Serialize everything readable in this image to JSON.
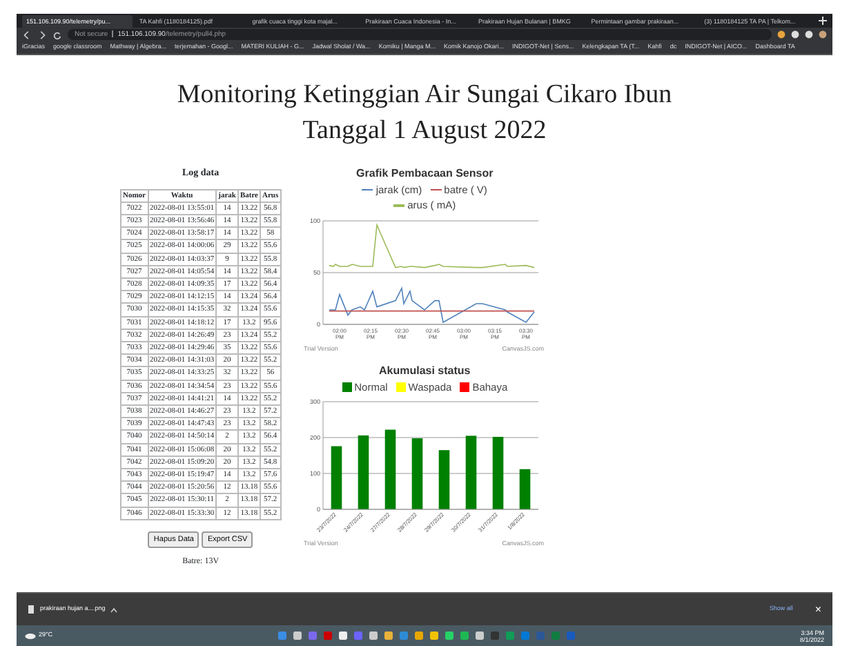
{
  "browser": {
    "tabs": [
      {
        "title": "151.106.109.90/telemetry/pu...",
        "selected": true
      },
      {
        "title": "TA Kahfi (1180184125).pdf",
        "selected": false
      },
      {
        "title": "grafik cuaca tinggi kota majal...",
        "selected": false
      },
      {
        "title": "Prakiraan Cuaca Indonesia - In...",
        "selected": false
      },
      {
        "title": "Prakiraan Hujan Bulanan | BMKG",
        "selected": false
      },
      {
        "title": "Permintaan gambar prakiraan...",
        "selected": false
      },
      {
        "title": "(3) 1180184125 TA PA | Telkom...",
        "selected": false
      }
    ],
    "address": {
      "security": "Not secure",
      "host": "151.106.109.90",
      "path": "/telemetry/pull4.php"
    },
    "bookmarks": [
      "iGracias",
      "google classroom",
      "Mathway | Algebra...",
      "terjemahan - Googl...",
      "MATERI KULIAH - G...",
      "Jadwal Sholat / Wa...",
      "Komiku | Manga M...",
      "Komik Kanojo Okari...",
      "INDIGOT-Net | Sens...",
      "Kelengkapan TA (T...",
      "Kahfi",
      "dc",
      "INDIGOT-Net | AICO...",
      "Dashboard TA"
    ]
  },
  "page": {
    "title_lines": [
      "Monitoring Ketinggian Air Sungai Cikaro Ibun",
      "Tanggal 1 August 2022"
    ],
    "log": {
      "heading": "Log data",
      "columns": [
        "Nomor",
        "Waktu",
        "jarak",
        "Batre",
        "Arus"
      ],
      "rows": [
        [
          "7022",
          "2022-08-01 13:55:01",
          "14",
          "13.22",
          "56.8"
        ],
        [
          "7023",
          "2022-08-01 13:56:46",
          "14",
          "13.22",
          "55.8"
        ],
        [
          "7024",
          "2022-08-01 13:58:17",
          "14",
          "13.22",
          "58"
        ],
        [
          "7025",
          "2022-08-01 14:00:06",
          "29",
          "13.22",
          "55.6"
        ],
        [
          "7026",
          "2022-08-01 14:03:37",
          "9",
          "13.22",
          "55.8"
        ],
        [
          "7027",
          "2022-08-01 14:05:54",
          "14",
          "13.22",
          "58.4"
        ],
        [
          "7028",
          "2022-08-01 14:09:35",
          "17",
          "13.22",
          "56.4"
        ],
        [
          "7029",
          "2022-08-01 14:12:15",
          "14",
          "13.24",
          "56.4"
        ],
        [
          "7030",
          "2022-08-01 14:15:35",
          "32",
          "13.24",
          "55.6"
        ],
        [
          "7031",
          "2022-08-01 14:18:12",
          "17",
          "13.2",
          "95.6"
        ],
        [
          "7032",
          "2022-08-01 14:26:49",
          "23",
          "13.24",
          "55.2"
        ],
        [
          "7033",
          "2022-08-01 14:29:46",
          "35",
          "13.22",
          "55.6"
        ],
        [
          "7034",
          "2022-08-01 14:31:03",
          "20",
          "13.22",
          "55.2"
        ],
        [
          "7035",
          "2022-08-01 14:33:25",
          "32",
          "13.22",
          "56"
        ],
        [
          "7036",
          "2022-08-01 14:34:54",
          "23",
          "13.22",
          "55.6"
        ],
        [
          "7037",
          "2022-08-01 14:41:21",
          "14",
          "13.22",
          "55.2"
        ],
        [
          "7038",
          "2022-08-01 14:46:27",
          "23",
          "13.2",
          "57.2"
        ],
        [
          "7039",
          "2022-08-01 14:47:43",
          "23",
          "13.2",
          "58.2"
        ],
        [
          "7040",
          "2022-08-01 14:50:14",
          "2",
          "13.2",
          "56.4"
        ],
        [
          "7041",
          "2022-08-01 15:06:08",
          "20",
          "13.2",
          "55.2"
        ],
        [
          "7042",
          "2022-08-01 15:09:20",
          "20",
          "13.2",
          "54.8"
        ],
        [
          "7043",
          "2022-08-01 15:19:47",
          "14",
          "13.2",
          "57.6"
        ],
        [
          "7044",
          "2022-08-01 15:20:56",
          "12",
          "13.18",
          "55.6"
        ],
        [
          "7045",
          "2022-08-01 15:30:11",
          "2",
          "13.18",
          "57.2"
        ],
        [
          "7046",
          "2022-08-01 15:33:30",
          "12",
          "13.18",
          "55.2"
        ]
      ]
    },
    "buttons": [
      "Hapus Data",
      "Export CSV"
    ],
    "battery": "Batre: 13V",
    "charts": [
      {
        "credits": [
          "Trial Version",
          "CanvasJS.com"
        ],
        "chart_data": {
          "type": "line",
          "title": "Grafik Pembacaan Sensor",
          "legend": true,
          "x": [
            835,
            837,
            838,
            840,
            844,
            846,
            850,
            852,
            856,
            858,
            867,
            870,
            871,
            874,
            875,
            881,
            886,
            888,
            890,
            906,
            909,
            920,
            921,
            930,
            934
          ],
          "xlim": [
            832,
            936
          ],
          "ylim": [
            0,
            100
          ],
          "yticks": [
            0,
            50,
            100
          ],
          "xticks": [
            {
              "value": 840,
              "label": "02:00 PM"
            },
            {
              "value": 855,
              "label": "02:15 PM"
            },
            {
              "value": 870,
              "label": "02:30 PM"
            },
            {
              "value": 885,
              "label": "02:45 PM"
            },
            {
              "value": 900,
              "label": "03:00 PM"
            },
            {
              "value": 915,
              "label": "03:15 PM"
            },
            {
              "value": 930,
              "label": "03:30 PM"
            }
          ],
          "series": [
            {
              "name": "jarak (cm)",
              "color": "#4f81bc",
              "values": [
                14,
                14,
                14,
                29,
                9,
                14,
                17,
                14,
                32,
                17,
                23,
                35,
                20,
                32,
                23,
                14,
                23,
                23,
                2,
                20,
                20,
                14,
                12,
                2,
                12
              ]
            },
            {
              "name": "batre ( V)",
              "color": "#c0504e",
              "values": [
                13,
                13,
                13,
                13,
                13,
                13,
                13,
                13,
                13,
                13,
                13,
                13,
                13,
                13,
                13,
                13,
                13,
                13,
                13,
                13,
                13,
                13,
                13,
                13,
                13
              ]
            },
            {
              "name": "arus ( mA)",
              "color": "#9bbb58",
              "values": [
                57,
                56,
                58,
                56,
                56,
                58,
                56,
                56,
                56,
                96,
                55,
                56,
                55,
                56,
                56,
                55,
                57,
                58,
                56,
                55,
                55,
                58,
                56,
                57,
                55
              ]
            }
          ]
        }
      },
      {
        "credits": [
          "Trial Version",
          "CanvasJS.com"
        ],
        "chart_data": {
          "type": "bar",
          "title": "Akumulasi status",
          "legend": true,
          "categories": [
            "23/7/2022",
            "24/7/2022",
            "27/7/2022",
            "28/7/2022",
            "29/7/2022",
            "30/7/2022",
            "31/7/2022",
            "1/8/2022"
          ],
          "ylim": [
            0,
            300
          ],
          "yticks": [
            0,
            100,
            200,
            300
          ],
          "series": [
            {
              "name": "Normal",
              "color": "#008000",
              "values": [
                176,
                206,
                222,
                198,
                165,
                205,
                202,
                112
              ]
            },
            {
              "name": "Waspada",
              "color": "#ffff00",
              "values": [
                null,
                null,
                null,
                null,
                null,
                null,
                null,
                null
              ]
            },
            {
              "name": "Bahaya",
              "color": "#ff0000",
              "values": [
                null,
                null,
                null,
                null,
                null,
                null,
                null,
                null
              ]
            }
          ]
        }
      }
    ]
  },
  "download_bar": {
    "file": "prakiraan hujan a....png",
    "show_all": "Show all",
    "close": "×"
  },
  "taskbar": {
    "weather": "29°C",
    "time": "3:34 PM",
    "date": "8/1/2022"
  }
}
